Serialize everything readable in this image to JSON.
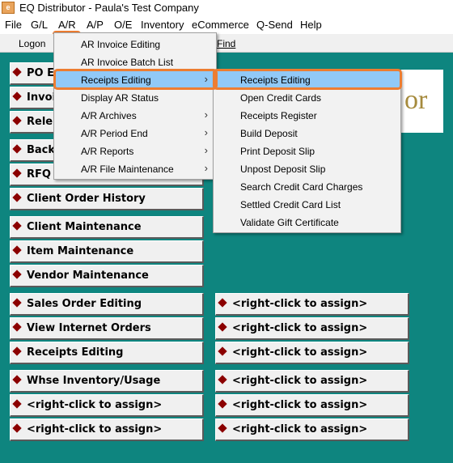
{
  "window": {
    "title": "EQ Distributor - Paula's Test Company",
    "icon_text": "e"
  },
  "menubar": {
    "file": "File",
    "gl": "G/L",
    "ar": "A/R",
    "ap": "A/P",
    "oe": "O/E",
    "inventory": "Inventory",
    "ecommerce": "eCommerce",
    "qsend": "Q-Send",
    "help": "Help"
  },
  "toolbar": {
    "logon": "Logon",
    "find": "Find"
  },
  "logo": {
    "text": "or"
  },
  "ar_menu": {
    "items": [
      {
        "label": "AR Invoice Editing"
      },
      {
        "label": "AR Invoice Batch List"
      },
      {
        "label": "Receipts Editing",
        "submenu": true,
        "selected": true
      },
      {
        "label": "Display AR Status"
      },
      {
        "label": "A/R Archives",
        "submenu": true
      },
      {
        "label": "A/R Period End",
        "submenu": true
      },
      {
        "label": "A/R Reports",
        "submenu": true
      },
      {
        "label": "A/R File Maintenance",
        "submenu": true
      }
    ],
    "arrow": "›"
  },
  "receipts_menu": {
    "items": [
      {
        "label": "Receipts Editing",
        "selected": true
      },
      {
        "label": "Open Credit Cards"
      },
      {
        "label": "Receipts Register"
      },
      {
        "label": "Build Deposit"
      },
      {
        "label": "Print Deposit Slip"
      },
      {
        "label": "Unpost Deposit Slip"
      },
      {
        "label": "Search Credit Card Charges"
      },
      {
        "label": "Settled Credit Card List"
      },
      {
        "label": "Validate Gift Certificate"
      }
    ]
  },
  "shortcuts": {
    "left": [
      "PO E",
      "Invoi",
      "Rele",
      "Back",
      "RFQ",
      "Client Order History",
      "Client Maintenance",
      "Item Maintenance",
      "Vendor Maintenance",
      "Sales Order Editing",
      "View Internet Orders",
      "Receipts Editing",
      "Whse Inventory/Usage",
      "<right-click to assign>",
      "<right-click to assign>"
    ],
    "right": [
      "<right-click to assign>",
      "<right-click to assign>",
      "<right-click to assign>",
      "<right-click to assign>",
      "<right-click to assign>",
      "<right-click to assign>"
    ]
  },
  "colors": {
    "desktop": "#0e857f",
    "highlight": "#91c9f7",
    "annotation": "#ed7d31",
    "bullet": "#8b0000"
  }
}
